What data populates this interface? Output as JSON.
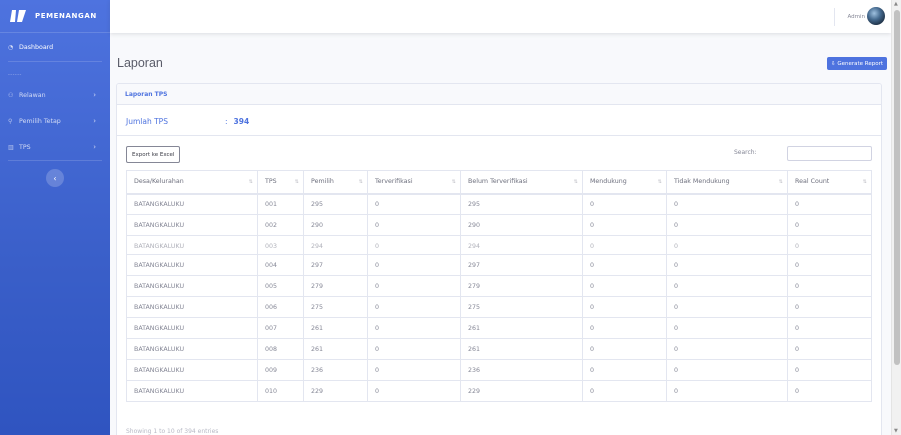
{
  "brand": {
    "name": "PEMENANGAN"
  },
  "sidebar": {
    "items": [
      {
        "label": "Dashboard",
        "icon": "dashboard-icon"
      },
      {
        "label": "Relawan",
        "icon": "users-icon"
      },
      {
        "label": "Pemilih Tetap",
        "icon": "user-icon"
      },
      {
        "label": "TPS",
        "icon": "building-icon"
      }
    ],
    "heading": "------",
    "toggle": "‹"
  },
  "topbar": {
    "user": "Admin"
  },
  "page": {
    "title": "Laporan",
    "generate_label": "⇩ Generate Report"
  },
  "card": {
    "header": "Laporan TPS",
    "summary_label": "Jumlah TPS",
    "summary_sep": ":",
    "summary_value": "394"
  },
  "table_controls": {
    "export_label": "Export ke Excel",
    "search_label": "Search:"
  },
  "table": {
    "columns": [
      "Desa/Kelurahan",
      "TPS",
      "Pemilih",
      "Terverifikasi",
      "Belum Terverifikasi",
      "Mendukung",
      "Tidak Mendukung",
      "Real Count"
    ],
    "rows": [
      [
        "BATANGKALUKU",
        "001",
        "295",
        "0",
        "295",
        "0",
        "0",
        "0"
      ],
      [
        "BATANGKALUKU",
        "002",
        "290",
        "0",
        "290",
        "0",
        "0",
        "0"
      ],
      [
        "BATANGKALUKU",
        "003",
        "294",
        "0",
        "294",
        "0",
        "0",
        "0"
      ],
      [
        "BATANGKALUKU",
        "004",
        "297",
        "0",
        "297",
        "0",
        "0",
        "0"
      ],
      [
        "BATANGKALUKU",
        "005",
        "279",
        "0",
        "279",
        "0",
        "0",
        "0"
      ],
      [
        "BATANGKALUKU",
        "006",
        "275",
        "0",
        "275",
        "0",
        "0",
        "0"
      ],
      [
        "BATANGKALUKU",
        "007",
        "261",
        "0",
        "261",
        "0",
        "0",
        "0"
      ],
      [
        "BATANGKALUKU",
        "008",
        "261",
        "0",
        "261",
        "0",
        "0",
        "0"
      ],
      [
        "BATANGKALUKU",
        "009",
        "236",
        "0",
        "236",
        "0",
        "0",
        "0"
      ],
      [
        "BATANGKALUKU",
        "010",
        "229",
        "0",
        "229",
        "0",
        "0",
        "0"
      ]
    ]
  },
  "footer": {
    "info": "Showing 1 to 10 of 394 entries"
  },
  "colors": {
    "primary": "#4e73df",
    "text": "#858796"
  }
}
